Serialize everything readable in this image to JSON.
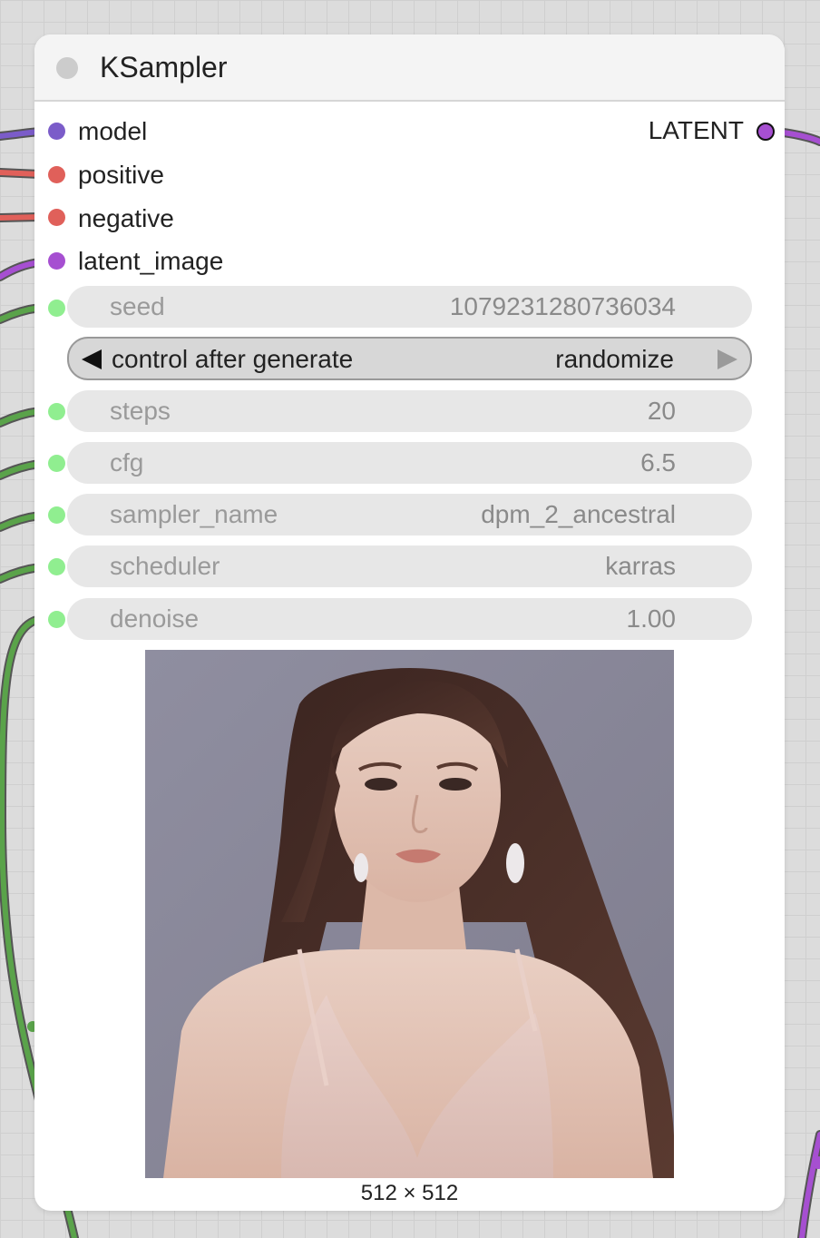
{
  "node": {
    "title": "KSampler",
    "inputs": [
      {
        "label": "model",
        "color": "#7b5cc9"
      },
      {
        "label": "positive",
        "color": "#e0605a"
      },
      {
        "label": "negative",
        "color": "#e0605a"
      },
      {
        "label": "latent_image",
        "color": "#a64fd1"
      }
    ],
    "output": {
      "label": "LATENT",
      "color": "#a64fd1"
    },
    "widgets": {
      "seed": {
        "label": "seed",
        "value": "1079231280736034"
      },
      "control_after_generate": {
        "label": "control after generate",
        "value": "randomize"
      },
      "steps": {
        "label": "steps",
        "value": "20"
      },
      "cfg": {
        "label": "cfg",
        "value": "6.5"
      },
      "sampler_name": {
        "label": "sampler_name",
        "value": "dpm_2_ancestral"
      },
      "scheduler": {
        "label": "scheduler",
        "value": "karras"
      },
      "denoise": {
        "label": "denoise",
        "value": "1.00"
      }
    },
    "widget_slot_color": "#90ee90",
    "preview": {
      "caption": "512 × 512"
    }
  },
  "links": {
    "model_color": "#7b5cc9",
    "conditioning_color": "#e0605a",
    "latent_color": "#a64fd1",
    "widget_link_color": "#5aa34a"
  }
}
